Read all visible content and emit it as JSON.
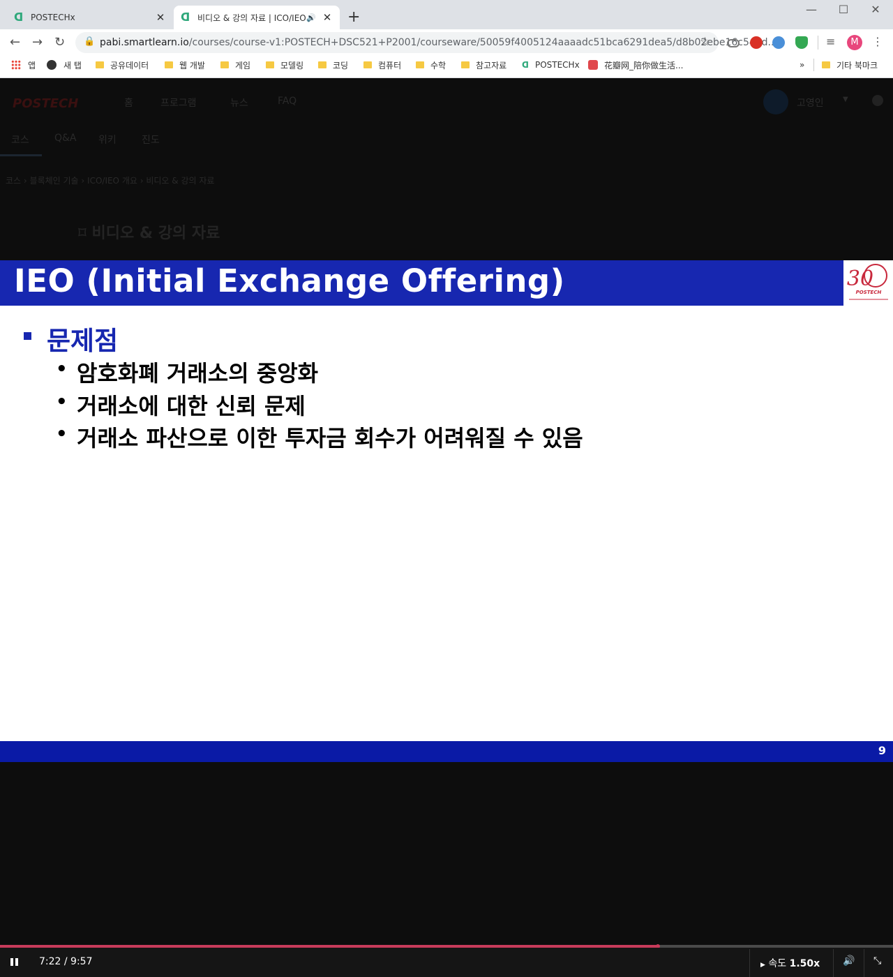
{
  "browser": {
    "tabs": [
      {
        "title": "POSTECHx",
        "active": false
      },
      {
        "title": "비디오 & 강의 자료 | ICO/IEO",
        "active": true
      }
    ],
    "url_host": "pabi.smartlearn.io",
    "url_path": "/courses/course-v1:POSTECH+DSC521+P2001/courseware/50059f4005124aaaadc51bca6291dea5/d8b02ebe16c544d...",
    "profile_initial": "M",
    "bookmarks": [
      "앱",
      "새 탭",
      "공유데이터",
      "웹 개발",
      "게임",
      "모델링",
      "코딩",
      "컴퓨터",
      "수학",
      "참고자료",
      "POSTECHx",
      "花瓣网_陪你做生活..."
    ],
    "bookmarks_overflow": "»",
    "other_bookmarks": "기타 북마크"
  },
  "page": {
    "logo": "POSTECH",
    "nav": [
      "홈",
      "프로그램",
      "뉴스",
      "FAQ"
    ],
    "user_name": "고영인",
    "course_tabs": [
      "코스",
      "Q&A",
      "위키",
      "진도"
    ],
    "breadcrumb": [
      "코스",
      "블록체인 기술",
      "ICO/IEO 개요",
      "비디오 & 강의 자료"
    ],
    "unit_title": "비디오 & 강의 자료"
  },
  "slide": {
    "title": "IEO (Initial Exchange Offering)",
    "heading": "문제점",
    "items": [
      "암호화폐 거래소의 중앙화",
      "거래소에 대한 신뢰 문제",
      "거래소 파산으로 이한 투자금 회수가 어려워질 수 있음"
    ],
    "page_number": "9",
    "logo_number": "30",
    "logo_text": "POSTECH"
  },
  "video": {
    "time_display": "7:22 / 9:57",
    "progress": 0.737,
    "speed_label": "속도",
    "speed_value": "1.50x"
  },
  "colors": {
    "slide_blue": "#1727b0",
    "footer_blue": "#0a1aa6",
    "progress": "#c73b5a"
  }
}
